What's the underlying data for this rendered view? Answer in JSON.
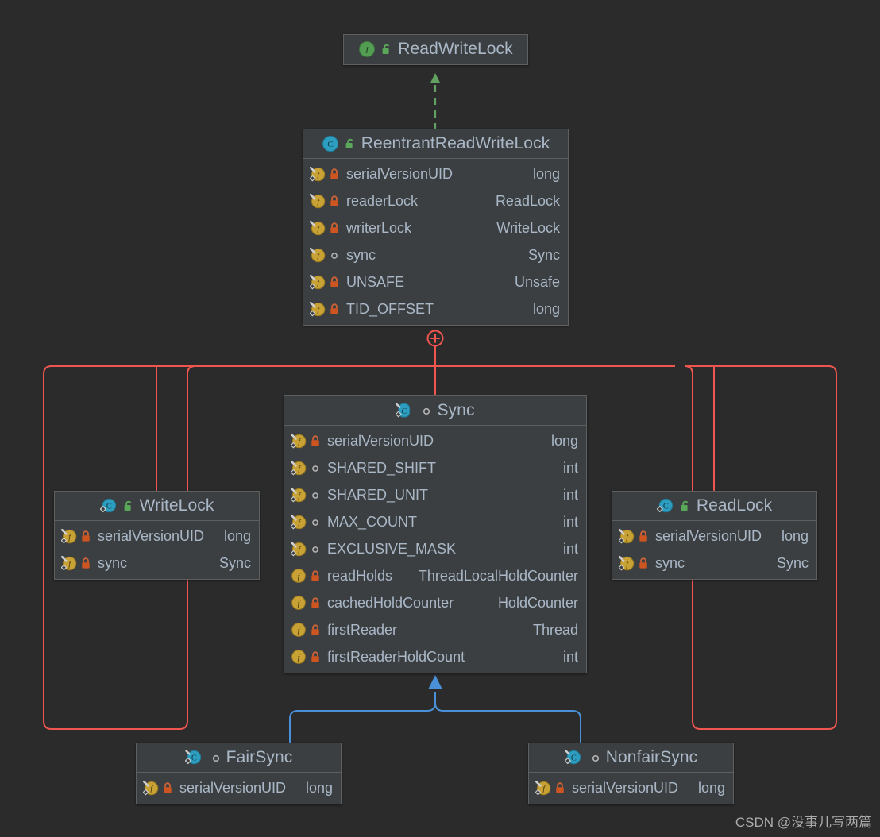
{
  "diagram": {
    "title": "ReentrantReadWriteLock UML class diagram",
    "background_color": "#2b2b2b",
    "node_fill": "#3c3f41",
    "node_border": "#5e6060",
    "text_color": "#a9b7c6",
    "edge_colors": {
      "realization": "#62a161",
      "inheritance": "#4a90d9",
      "inner_class": "#f0554f"
    }
  },
  "nodes": {
    "readwritelock": {
      "name": "ReadWriteLock",
      "kind_icon": "interface-icon",
      "visibility_icon": "public-unlock-icon",
      "members": []
    },
    "reentrantreadwritelock": {
      "name": "ReentrantReadWriteLock",
      "kind_icon": "class-icon",
      "visibility_icon": "public-unlock-icon",
      "members": [
        {
          "icon": "static-field-icon",
          "visibility_icon": "private-lock-icon",
          "name": "serialVersionUID",
          "type": "long"
        },
        {
          "icon": "field-icon",
          "visibility_icon": "private-lock-icon",
          "name": "readerLock",
          "type": "ReadLock"
        },
        {
          "icon": "field-icon",
          "visibility_icon": "private-lock-icon",
          "name": "writerLock",
          "type": "WriteLock"
        },
        {
          "icon": "field-icon",
          "visibility_icon": "package-circle-icon",
          "name": "sync",
          "type": "Sync"
        },
        {
          "icon": "static-field-icon",
          "visibility_icon": "private-lock-icon",
          "name": "UNSAFE",
          "type": "Unsafe"
        },
        {
          "icon": "static-field-icon",
          "visibility_icon": "private-lock-icon",
          "name": "TID_OFFSET",
          "type": "long"
        }
      ]
    },
    "sync": {
      "name": "Sync",
      "kind_icon": "abstract-static-class-icon",
      "visibility_icon": "package-circle-icon",
      "members": [
        {
          "icon": "static-field-icon",
          "visibility_icon": "private-lock-icon",
          "name": "serialVersionUID",
          "type": "long"
        },
        {
          "icon": "static-field-icon",
          "visibility_icon": "package-circle-icon",
          "name": "SHARED_SHIFT",
          "type": "int"
        },
        {
          "icon": "static-field-icon",
          "visibility_icon": "package-circle-icon",
          "name": "SHARED_UNIT",
          "type": "int"
        },
        {
          "icon": "static-field-icon",
          "visibility_icon": "package-circle-icon",
          "name": "MAX_COUNT",
          "type": "int"
        },
        {
          "icon": "static-field-icon",
          "visibility_icon": "package-circle-icon",
          "name": "EXCLUSIVE_MASK",
          "type": "int"
        },
        {
          "icon": "field-icon",
          "visibility_icon": "private-lock-icon",
          "name": "readHolds",
          "type": "ThreadLocalHoldCounter"
        },
        {
          "icon": "field-icon",
          "visibility_icon": "private-lock-icon",
          "name": "cachedHoldCounter",
          "type": "HoldCounter"
        },
        {
          "icon": "field-icon",
          "visibility_icon": "private-lock-icon",
          "name": "firstReader",
          "type": "Thread"
        },
        {
          "icon": "field-icon",
          "visibility_icon": "private-lock-icon",
          "name": "firstReaderHoldCount",
          "type": "int"
        }
      ]
    },
    "writelock": {
      "name": "WriteLock",
      "kind_icon": "static-class-icon",
      "visibility_icon": "public-unlock-icon",
      "members": [
        {
          "icon": "static-field-icon",
          "visibility_icon": "private-lock-icon",
          "name": "serialVersionUID",
          "type": "long"
        },
        {
          "icon": "static-field-icon",
          "visibility_icon": "private-lock-icon",
          "name": "sync",
          "type": "Sync"
        }
      ]
    },
    "readlock": {
      "name": "ReadLock",
      "kind_icon": "static-class-icon",
      "visibility_icon": "public-unlock-icon",
      "members": [
        {
          "icon": "static-field-icon",
          "visibility_icon": "private-lock-icon",
          "name": "serialVersionUID",
          "type": "long"
        },
        {
          "icon": "static-field-icon",
          "visibility_icon": "private-lock-icon",
          "name": "sync",
          "type": "Sync"
        }
      ]
    },
    "fairsync": {
      "name": "FairSync",
      "kind_icon": "static-class-icon",
      "visibility_icon": "package-circle-icon",
      "members": [
        {
          "icon": "static-field-icon",
          "visibility_icon": "private-lock-icon",
          "name": "serialVersionUID",
          "type": "long"
        }
      ]
    },
    "nonfairsync": {
      "name": "NonfairSync",
      "kind_icon": "static-class-icon",
      "visibility_icon": "package-circle-icon",
      "members": [
        {
          "icon": "static-field-icon",
          "visibility_icon": "private-lock-icon",
          "name": "serialVersionUID",
          "type": "long"
        }
      ]
    }
  },
  "edges": [
    {
      "from": "ReentrantReadWriteLock",
      "to": "ReadWriteLock",
      "type": "realization",
      "style": "dashed",
      "arrow": "triangle"
    },
    {
      "from": "FairSync",
      "to": "Sync",
      "type": "inheritance",
      "style": "solid",
      "arrow": "triangle"
    },
    {
      "from": "NonfairSync",
      "to": "Sync",
      "type": "inheritance",
      "style": "solid",
      "arrow": "triangle"
    },
    {
      "from": "ReentrantReadWriteLock",
      "to": "WriteLock",
      "type": "inner-class",
      "style": "solid",
      "arrow": "none"
    },
    {
      "from": "ReentrantReadWriteLock",
      "to": "ReadLock",
      "type": "inner-class",
      "style": "solid",
      "arrow": "none"
    },
    {
      "from": "ReentrantReadWriteLock",
      "to": "Sync",
      "type": "inner-class",
      "style": "solid",
      "arrow": "none"
    },
    {
      "from": "ReentrantReadWriteLock",
      "to": "FairSync",
      "type": "inner-class",
      "style": "solid",
      "arrow": "none"
    },
    {
      "from": "ReentrantReadWriteLock",
      "to": "NonfairSync",
      "type": "inner-class",
      "style": "solid",
      "arrow": "none"
    }
  ],
  "controls": {
    "expand_node_label": "+"
  },
  "watermark": {
    "text": "CSDN @没事儿写两篇"
  }
}
